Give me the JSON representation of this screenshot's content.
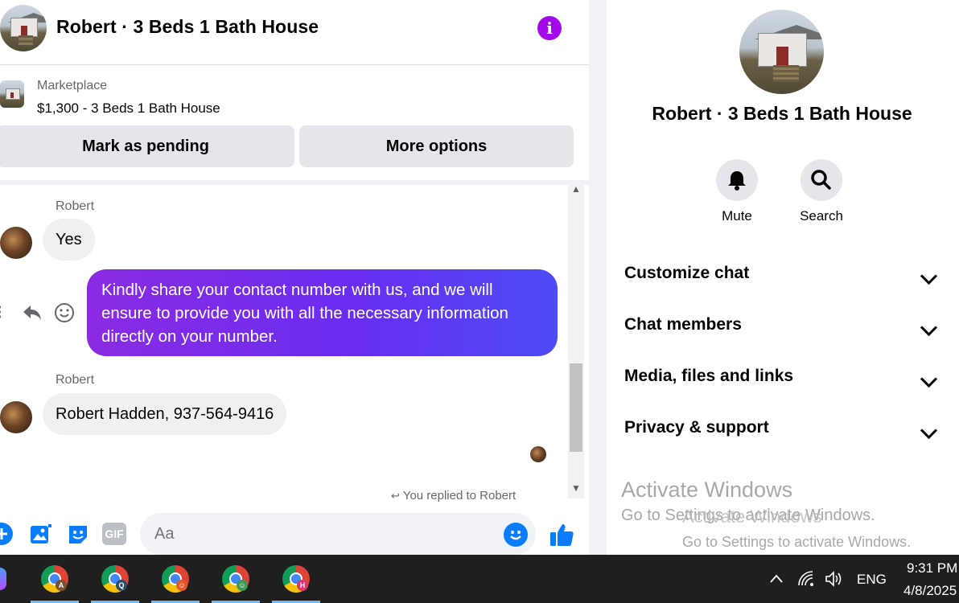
{
  "chat": {
    "title": "Robert · 3 Beds 1 Bath House",
    "marketplace_label": "Marketplace",
    "listing": "$1,300 - 3 Beds 1 Bath House",
    "mark_pending": "Mark as pending",
    "more_options": "More options",
    "messages": [
      {
        "sender": "Robert",
        "text": "Yes"
      },
      {
        "sender": "You",
        "text": "Kindly share your contact number with us, and we will ensure to provide you with all the necessary information directly on your number."
      },
      {
        "sender": "Robert",
        "text": "Robert Hadden, 937-564-9416"
      }
    ],
    "replied_note": "You replied to Robert",
    "composer_placeholder": "Aa",
    "gif_label": "GIF",
    "accent_color": "#a20ae8"
  },
  "info": {
    "title": "Robert · 3 Beds 1 Bath House",
    "actions": [
      {
        "label": "Mute",
        "icon": "bell-icon"
      },
      {
        "label": "Search",
        "icon": "search-icon"
      }
    ],
    "sections": [
      "Customize chat",
      "Chat members",
      "Media, files and links",
      "Privacy & support"
    ]
  },
  "watermark": {
    "line1": "Activate Windows",
    "line2": "Go to Settings to activate Windows."
  },
  "taskbar": {
    "apps": [
      {
        "icon": "chrome-icon",
        "badge": "A",
        "badge_color": "#7a5230"
      },
      {
        "icon": "chrome-icon",
        "badge": "Q",
        "badge_color": "#2a4d69"
      },
      {
        "icon": "chrome-icon",
        "badge": "",
        "badge_color": "#e25a2a"
      },
      {
        "icon": "chrome-icon",
        "badge": "",
        "badge_color": "#3f9a55"
      },
      {
        "icon": "chrome-icon",
        "badge": "H",
        "badge_color": "#e0336b"
      }
    ],
    "language": "ENG",
    "time": "9:31 PM",
    "date": "4/8/2025"
  }
}
